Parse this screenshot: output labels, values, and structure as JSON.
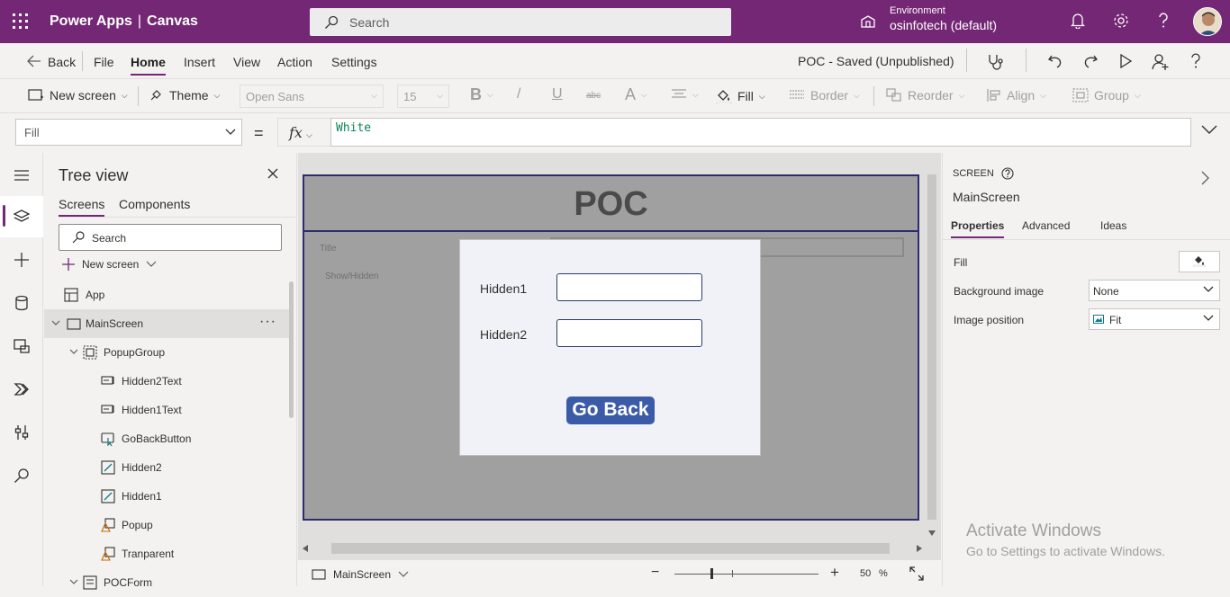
{
  "app": {
    "brand": "Power Apps",
    "separator": "|",
    "mode": "Canvas",
    "search_placeholder": "Search",
    "environment_label": "Environment",
    "environment_name": "osinfotech (default)"
  },
  "menubar": {
    "back_label": "Back",
    "items": [
      {
        "label": "File"
      },
      {
        "label": "Home",
        "active": true
      },
      {
        "label": "Insert"
      },
      {
        "label": "View"
      },
      {
        "label": "Action"
      },
      {
        "label": "Settings"
      }
    ],
    "save_status": "POC - Saved (Unpublished)"
  },
  "ribbon": {
    "new_screen": "New screen",
    "theme": "Theme",
    "font": "Open Sans",
    "font_size": "15",
    "bold": "B",
    "italic": "/",
    "underline": "U",
    "strike": "abc",
    "fontsize_icon": "A",
    "fill": "Fill",
    "border": "Border",
    "reorder": "Reorder",
    "align": "Align",
    "group": "Group"
  },
  "formula": {
    "property": "Fill",
    "equals": "=",
    "fx": "fx",
    "value": "White"
  },
  "tree": {
    "title": "Tree view",
    "tabs": [
      "Screens",
      "Components"
    ],
    "search_placeholder": "Search",
    "new_screen": "New screen",
    "items": [
      {
        "label": "App",
        "icon": "app-icon",
        "depth": 0
      },
      {
        "label": "MainScreen",
        "icon": "screen-icon",
        "depth": 0,
        "selected": true
      },
      {
        "label": "PopupGroup",
        "icon": "group-icon",
        "depth": 1
      },
      {
        "label": "Hidden2Text",
        "icon": "label-icon",
        "depth": 2
      },
      {
        "label": "Hidden1Text",
        "icon": "label-icon",
        "depth": 2
      },
      {
        "label": "GoBackButton",
        "icon": "button-icon",
        "depth": 2
      },
      {
        "label": "Hidden2",
        "icon": "text-input-icon",
        "depth": 2
      },
      {
        "label": "Hidden1",
        "icon": "text-input-icon",
        "depth": 2
      },
      {
        "label": "Popup",
        "icon": "shape-icon",
        "depth": 2
      },
      {
        "label": "Tranparent",
        "icon": "shape-icon",
        "depth": 2
      },
      {
        "label": "POCForm",
        "icon": "form-icon",
        "depth": 1
      }
    ],
    "more": "···"
  },
  "canvas": {
    "title": "POC",
    "label_title": "Title",
    "label_showhidden": "Show/Hidden",
    "popup": {
      "label1": "Hidden1",
      "label2": "Hidden2",
      "button": "Go Back"
    }
  },
  "status": {
    "screen": "MainScreen",
    "zoom_minus": "−",
    "zoom_plus": "+",
    "zoom_value": "50",
    "zoom_unit": "%"
  },
  "properties": {
    "kind": "SCREEN",
    "name": "MainScreen",
    "tabs": [
      "Properties",
      "Advanced",
      "Ideas"
    ],
    "fill_label": "Fill",
    "background_image_label": "Background image",
    "background_image_value": "None",
    "image_position_label": "Image position",
    "image_position_value": "Fit",
    "watermark_title": "Activate Windows",
    "watermark_sub": "Go to Settings to activate Windows."
  },
  "colors": {
    "brand": "#742774",
    "canvas_gray": "#a0a0a0",
    "popup_bg": "#f1f2f8",
    "button_blue": "#3b5ba8",
    "border_navy": "#2b2d6e"
  }
}
